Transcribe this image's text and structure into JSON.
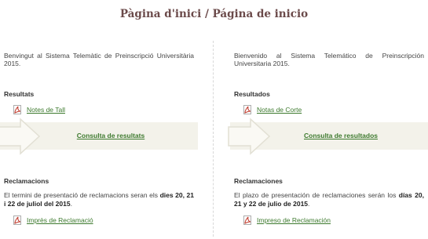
{
  "page": {
    "title": "Pàgina d'inici / Página de inicio"
  },
  "catalan": {
    "intro": "Benvingut al Sistema Telemàtic de Preinscripció Universitària 2015.",
    "results_heading": "Resultats",
    "results_link": "Notes de Tall",
    "consult_link": "Consulta de resultats",
    "claims_heading": "Reclamacions",
    "claims_text_1": "El termini de presentació de reclamacions seran els ",
    "claims_text_bold": "dies 20, 21 i 22 de juliol del 2015",
    "claims_text_2": ".",
    "claims_link": "Imprès de Reclamació"
  },
  "spanish": {
    "intro": "Bienvenido al Sistema Telemático de Preinscripción Universitaria 2015.",
    "results_heading": "Resultados",
    "results_link": "Notas de Corte",
    "consult_link": "Consulta de resultados",
    "claims_heading": "Reclamaciones",
    "claims_text_1": "El plazo de presentación de reclamaciones serán los ",
    "claims_text_bold": "días 20, 21 y 22 de julio de 2015",
    "claims_text_2": ".",
    "claims_link": "Impreso de Reclamación"
  },
  "colors": {
    "title": "#6b4a4a",
    "link": "#3d7a2e",
    "band": "#f3f2ea",
    "pdf": "#c0392b"
  },
  "icons": {
    "pdf": "pdf-icon",
    "arrow": "arrow-right-icon"
  }
}
